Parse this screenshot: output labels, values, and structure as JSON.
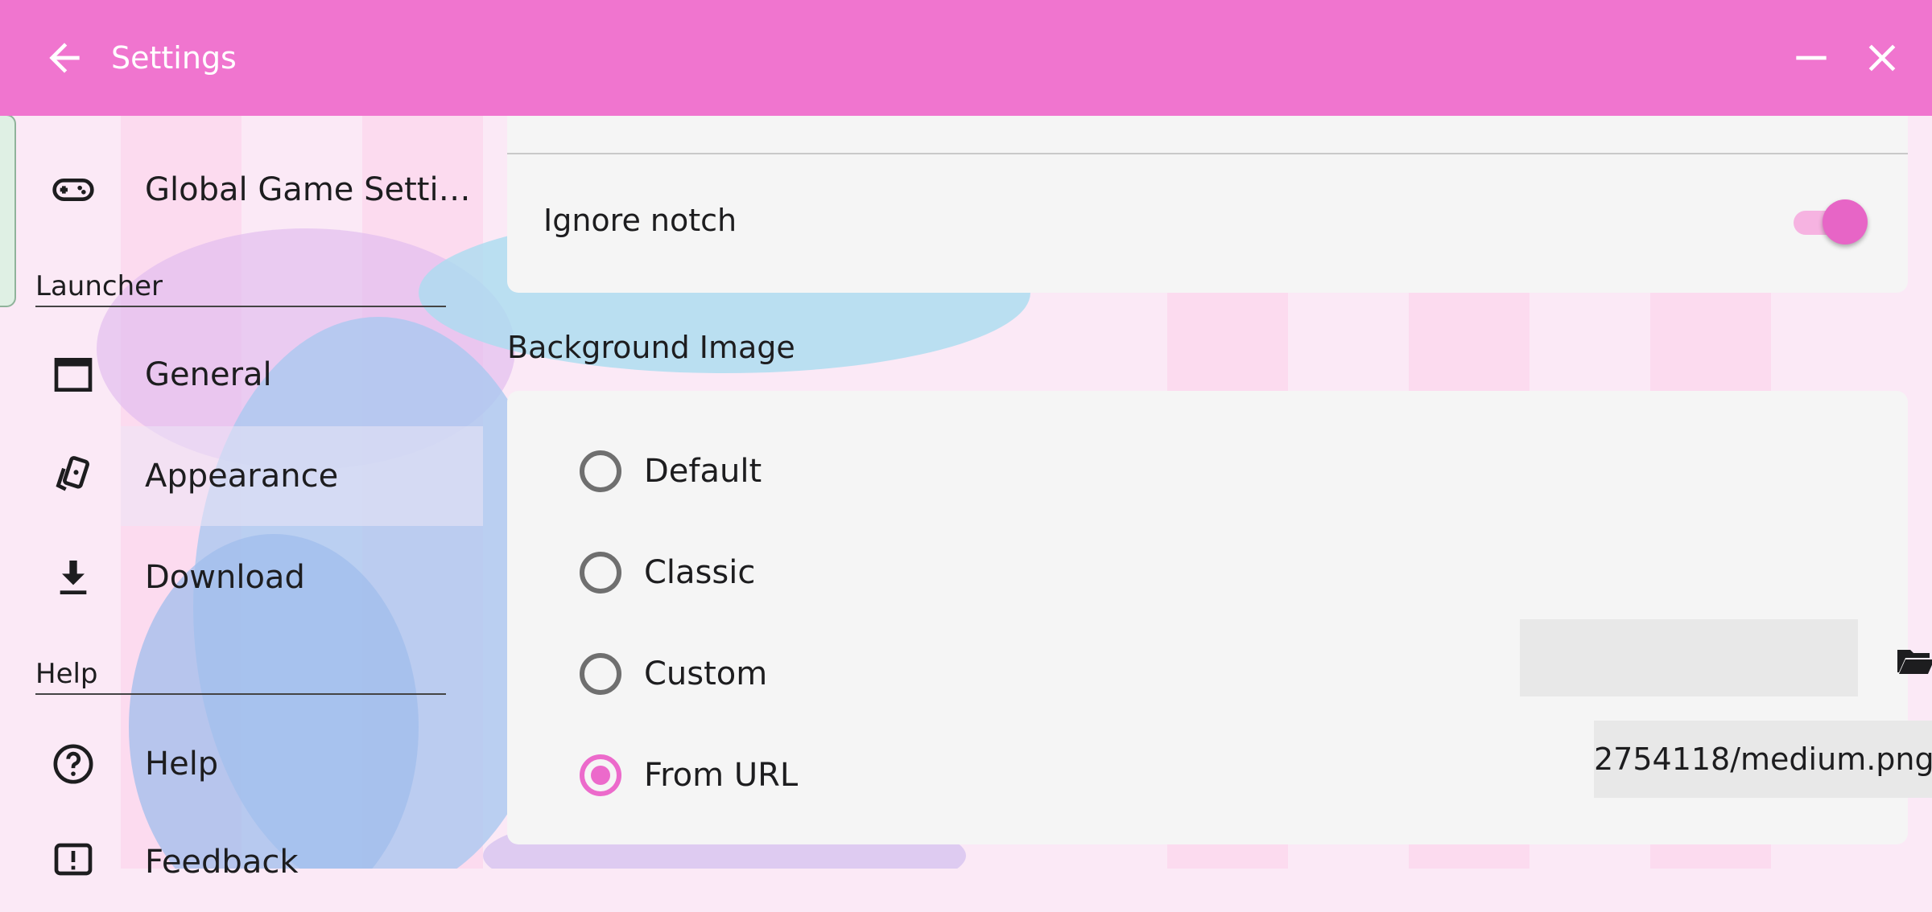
{
  "appbar": {
    "title": "Settings",
    "background": "#f075cf"
  },
  "sidebar": {
    "items_top": [
      {
        "label": "Global Game Setti…",
        "icon": "gamepad-icon"
      }
    ],
    "sections": [
      {
        "header": "Launcher",
        "items": [
          {
            "label": "General",
            "icon": "window-icon"
          },
          {
            "label": "Appearance",
            "icon": "cards-icon",
            "selected": true
          },
          {
            "label": "Download",
            "icon": "download-icon"
          }
        ]
      },
      {
        "header": "Help",
        "items": [
          {
            "label": "Help",
            "icon": "help-circle-icon"
          },
          {
            "label": "Feedback",
            "icon": "feedback-icon"
          }
        ]
      }
    ]
  },
  "settings": {
    "ignore_notch": {
      "label": "Ignore notch",
      "enabled": true
    },
    "background_image": {
      "title": "Background Image",
      "options": [
        {
          "label": "Default",
          "selected": false
        },
        {
          "label": "Classic",
          "selected": false
        },
        {
          "label": "Custom",
          "selected": false
        },
        {
          "label": "From URL",
          "selected": true
        }
      ],
      "url_value": "2754118/medium.png"
    }
  },
  "colors": {
    "accent": "#ec6acb",
    "card": "#f5f5f5"
  }
}
